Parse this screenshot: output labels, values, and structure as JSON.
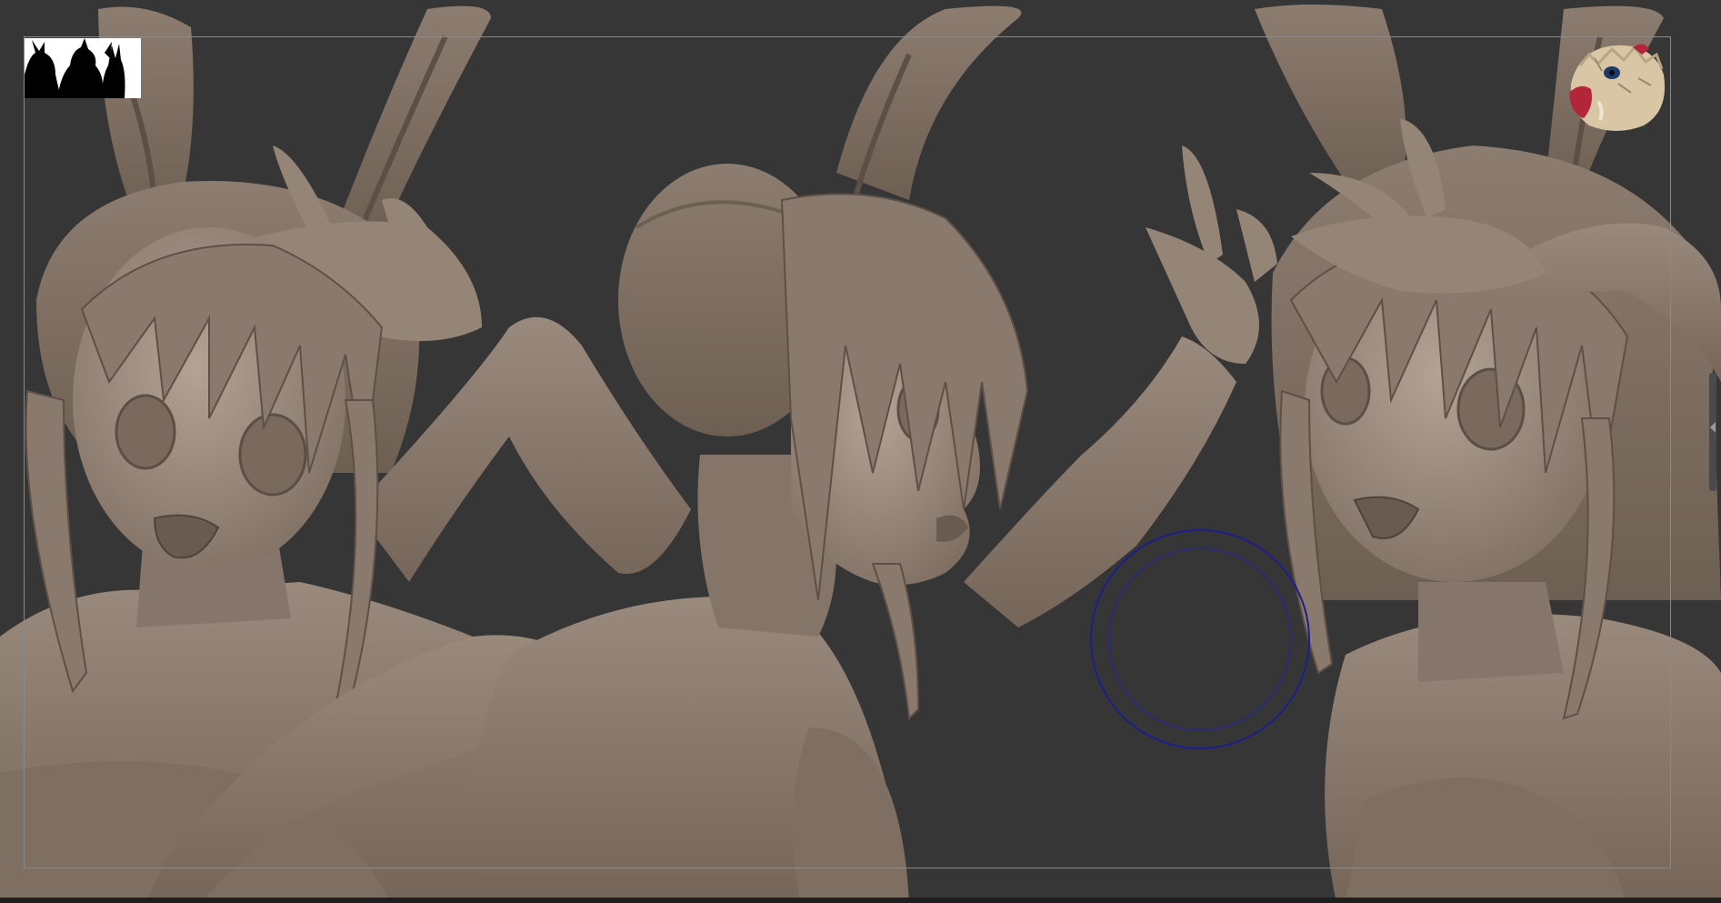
{
  "app": {
    "title": "",
    "viewport_background": "#363636",
    "frame_color": "#8a8a8a",
    "clay_color": "#8b7b6e"
  },
  "viewport": {
    "models": [
      {
        "id": "front-view",
        "description_icon": "bunny-girl-front-icon"
      },
      {
        "id": "side-view",
        "description_icon": "bunny-girl-side-icon"
      },
      {
        "id": "three-quarter-view",
        "description_icon": "bunny-girl-three-quarter-icon"
      }
    ],
    "brush_cursor": {
      "outer_color": "#1e1e8c",
      "inner_color": "#28288c"
    }
  },
  "thumbnails": {
    "left_icon": "silhouette-reference-icon",
    "right_icon": "boar-mask-reference-icon"
  }
}
